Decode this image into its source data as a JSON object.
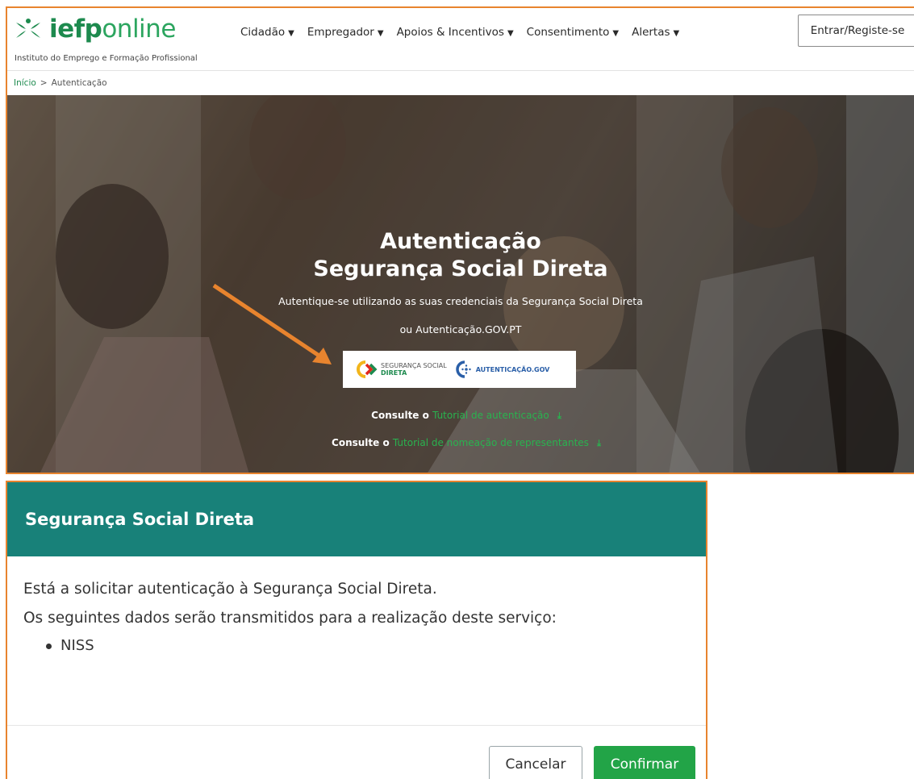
{
  "header": {
    "logo_bold": "iefp",
    "logo_light": "online",
    "tagline": "Instituto do Emprego e Formação Profissional",
    "nav": [
      {
        "label": "Cidadão"
      },
      {
        "label": "Empregador"
      },
      {
        "label": "Apoios & Incentivos"
      },
      {
        "label": "Consentimento"
      },
      {
        "label": "Alertas"
      }
    ],
    "login_label": "Entrar/Registe-se"
  },
  "breadcrumb": {
    "home": "Início",
    "separator": ">",
    "current": "Autenticação"
  },
  "hero": {
    "title_line1": "Autenticação",
    "title_line2": "Segurança Social Direta",
    "subtitle_line1": "Autentique-se utilizando as suas credenciais da Segurança Social Direta",
    "subtitle_line2": "ou Autenticação.GOV.PT",
    "provider_ss_line1": "SEGURANÇA SOCIAL",
    "provider_ss_line2": "DIRETA",
    "provider_gov": "AUTENTICAÇÃO.GOV",
    "consult1_prefix": "Consulte o",
    "consult1_link": "Tutorial de autenticação",
    "consult2_prefix": "Consulte o",
    "consult2_link": "Tutorial de nomeação de representantes",
    "download_icon": "download-icon"
  },
  "dialog": {
    "title": "Segurança Social Direta",
    "line1": "Está a solicitar autenticação à Segurança Social Direta.",
    "line2": "Os seguintes dados serão transmitidos para a realização deste serviço:",
    "items": [
      "NISS"
    ],
    "cancel_label": "Cancelar",
    "confirm_label": "Confirmar"
  },
  "colors": {
    "brand_green": "#1d8a4e",
    "dialog_header": "#188179",
    "confirm_button": "#22a447",
    "annotation_orange": "#e8842e"
  }
}
